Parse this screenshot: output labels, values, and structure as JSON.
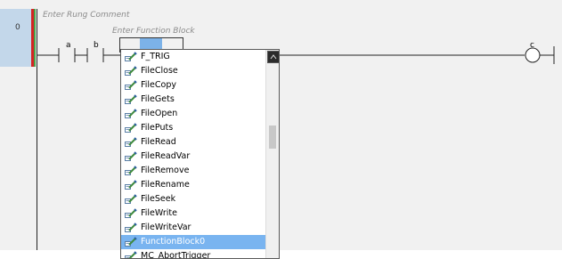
{
  "rung": {
    "number": "0",
    "comment_placeholder": "Enter Rung Comment"
  },
  "function_block": {
    "comment_placeholder": "Enter Function Block"
  },
  "contacts": [
    {
      "label": "a"
    },
    {
      "label": "b"
    }
  ],
  "coil": {
    "label": "c"
  },
  "autocomplete": {
    "items": [
      {
        "label": "F_TRIG"
      },
      {
        "label": "FileClose"
      },
      {
        "label": "FileCopy"
      },
      {
        "label": "FileGets"
      },
      {
        "label": "FileOpen"
      },
      {
        "label": "FilePuts"
      },
      {
        "label": "FileRead"
      },
      {
        "label": "FileReadVar"
      },
      {
        "label": "FileRemove"
      },
      {
        "label": "FileRename"
      },
      {
        "label": "FileSeek"
      },
      {
        "label": "FileWrite"
      },
      {
        "label": "FileWriteVar"
      },
      {
        "label": "FunctionBlock0",
        "selected": true
      },
      {
        "label": "MC_AbortTrigger"
      }
    ],
    "selected_label": "FunctionBlock0",
    "item_icon": "function-block-icon",
    "scroll_up_icon": "chevron-up-icon"
  },
  "colors": {
    "rail_red": "#d42323",
    "rail_green": "#4aa24a",
    "selection": "#79b4f0",
    "rung_number_bg": "#c3d7ea"
  }
}
